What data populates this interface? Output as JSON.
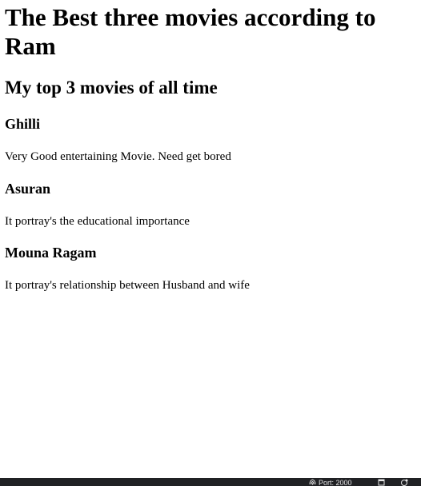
{
  "page": {
    "title": "The Best three movies according to Ram",
    "subtitle": "My top 3 movies of all time"
  },
  "movies": [
    {
      "name": "Ghilli",
      "description": "Very Good entertaining Movie. Need get bored"
    },
    {
      "name": "Asuran",
      "description": "It portray's the educational importance"
    },
    {
      "name": "Mouna Ragam",
      "description": "It portray's relationship between Husband and wife"
    }
  ],
  "statusbar": {
    "port_label": "Port: 2000",
    "icons": [
      "broadcast-icon",
      "window-icon",
      "feedback-icon"
    ]
  },
  "colors": {
    "background": "#ffffff",
    "text": "#000000",
    "statusbar": "#202124"
  }
}
